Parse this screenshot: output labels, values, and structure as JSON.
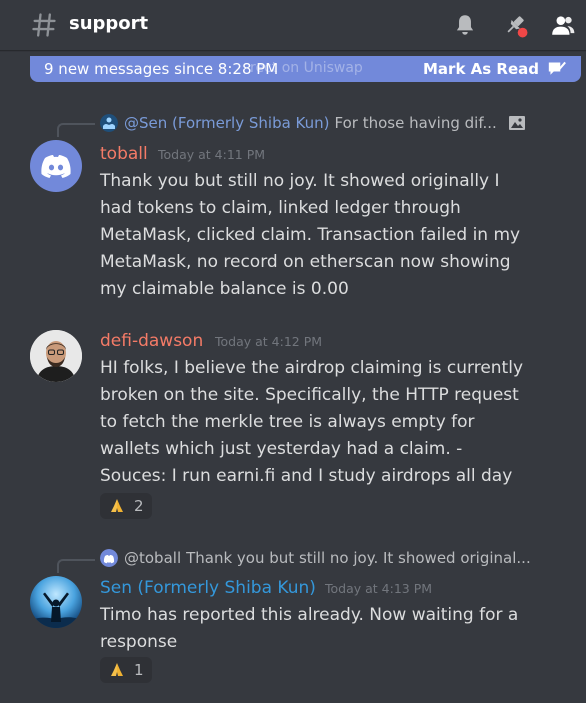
{
  "header": {
    "channel_name": "support",
    "icons": [
      "hash-icon",
      "bell-icon",
      "pin-icon",
      "members-icon"
    ]
  },
  "new_messages_bar": {
    "text": "9 new messages since 8:28 PM",
    "ghost_text": "rect on Uniswap",
    "action_label": "Mark As Read",
    "color": "#7289da"
  },
  "messages": [
    {
      "reply": {
        "mention": "@Sen (Formerly Shiba Kun)",
        "preview": "For those having dif..."
      },
      "author": "toball",
      "author_color": "#f47b67",
      "timestamp": "Today at 4:11 PM",
      "lines": [
        "Thank you but still no joy. It showed originally I",
        "had tokens to claim, linked ledger through",
        "MetaMask, clicked claim. Transaction failed in my",
        "MetaMask, no record on etherscan now showing",
        "my claimable balance is 0.00"
      ]
    },
    {
      "author": "defi-dawson",
      "author_color": "#f47b67",
      "timestamp": "Today at 4:12 PM",
      "lines": [
        "HI folks, I believe the airdrop claiming is currently",
        "broken on the site. Specifically, the HTTP request",
        "to fetch the merkle tree is always empty for",
        "wallets which just yesterday had a claim. -",
        "Souces: I run earni.fi and I study airdrops all day"
      ],
      "reaction": {
        "emoji": "folded-hands",
        "count": "2"
      }
    },
    {
      "reply": {
        "mention": "@toball",
        "preview": "Thank you but still no joy. It showed original..."
      },
      "author": "Sen (Formerly Shiba Kun)",
      "author_color": "#3498db",
      "timestamp": "Today at 4:13 PM",
      "lines": [
        "Timo has reported this already. Now waiting for a",
        "response"
      ],
      "reaction": {
        "emoji": "folded-hands",
        "count": "1"
      }
    }
  ]
}
